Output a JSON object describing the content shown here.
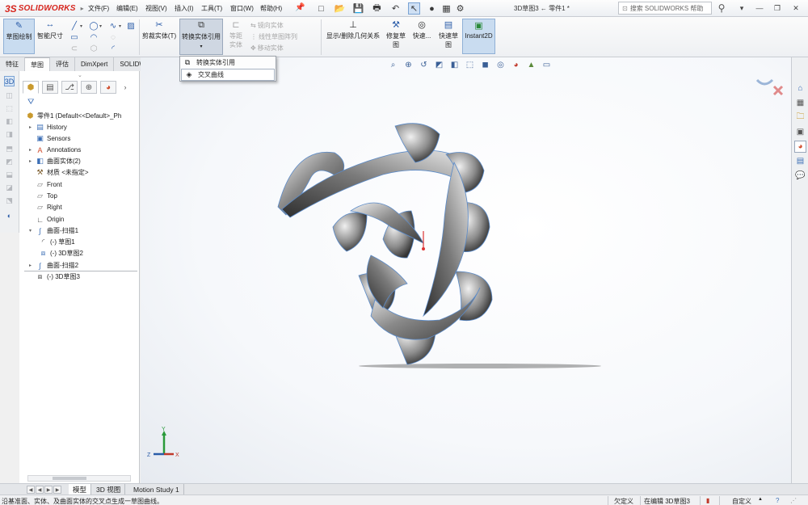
{
  "app": {
    "logo_text": "SOLIDWORKS",
    "document_title": "3D草图3 ← 零件1 *"
  },
  "menu": [
    "文件(F)",
    "编辑(E)",
    "视图(V)",
    "插入(I)",
    "工具(T)",
    "窗口(W)",
    "帮助(H)"
  ],
  "search": {
    "placeholder": "搜索 SOLIDWORKS 帮助"
  },
  "ribbon": {
    "sketch": "草图绘制",
    "smart_dimension": "智能尺寸",
    "trim": "剪裁实体(T)",
    "convert": "转换实体引用",
    "offset": "等距实体",
    "mirror": "镜向实体",
    "linear_pattern": "线性草图阵列",
    "move": "移动实体",
    "relations": "显示/删除几何关系",
    "repair": "修复草图",
    "quick_snaps": "快速...",
    "rapid_sketch": "快速草图",
    "instant2d": "Instant2D"
  },
  "dropdown": {
    "items": [
      "转换实体引用",
      "交叉曲线"
    ]
  },
  "tabs": [
    "特征",
    "草图",
    "评估",
    "DimXpert",
    "SOLIDWORKS 插"
  ],
  "tree": {
    "root": "零件1 (Default<<Default>_Ph",
    "items": [
      "History",
      "Sensors",
      "Annotations",
      "曲面实体(2)",
      "材质 <未指定>",
      "Front",
      "Top",
      "Right",
      "Origin",
      "曲面-扫描1",
      "(-) 草图1",
      "(-) 3D草图2",
      "曲面-扫描2",
      "(-) 3D草图3"
    ]
  },
  "bottom_tabs": [
    "模型",
    "3D 视图",
    "Motion Study 1"
  ],
  "status": {
    "hint": "沿基准面、实体、及曲面实体的交叉点生成一草图曲线。",
    "undefined": "欠定义",
    "editing": "在编辑 3D草图3",
    "custom": "自定义"
  },
  "triad": {
    "x": "X",
    "y": "Y",
    "z": "Z"
  },
  "colors": {
    "brand": "#d7261e",
    "accent": "#3d6fb6",
    "selection": "#cfe0f4"
  }
}
